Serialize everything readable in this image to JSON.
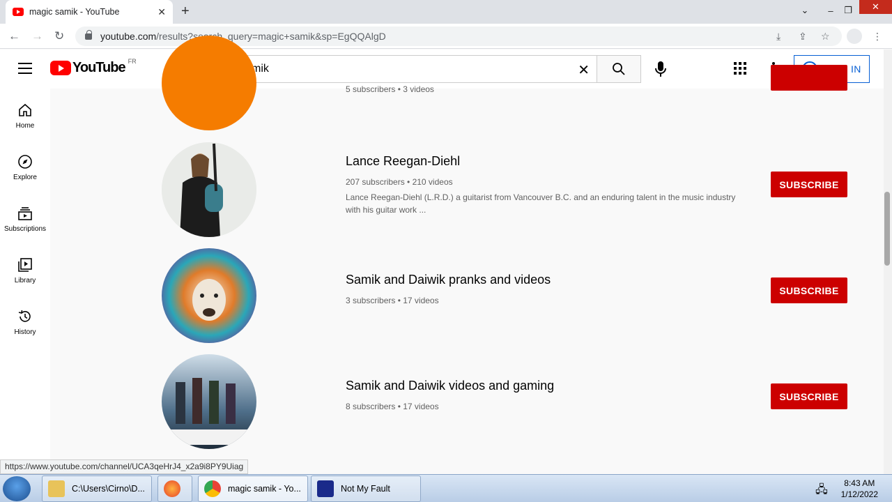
{
  "browser": {
    "tab_title": "magic samik - YouTube",
    "new_tab": "+",
    "url_domain": "youtube.com",
    "url_path": "/results?search_query=magic+samik&sp=EgQQAlgD",
    "status_url": "https://www.youtube.com/channel/UCA3qeHrJ4_x2a9i8PY9Uiag"
  },
  "header": {
    "logo_text": "YouTube",
    "region": "FR",
    "search_value": "magic samik",
    "signin_label": "SIGN IN"
  },
  "sidebar": {
    "items": [
      {
        "label": "Home",
        "icon": "home-icon"
      },
      {
        "label": "Explore",
        "icon": "compass-icon"
      },
      {
        "label": "Subscriptions",
        "icon": "subscriptions-icon"
      },
      {
        "label": "Library",
        "icon": "library-icon"
      },
      {
        "label": "History",
        "icon": "history-icon"
      }
    ]
  },
  "results": [
    {
      "name": "",
      "meta": "5 subscribers • 3 videos",
      "desc": "",
      "subscribe": ""
    },
    {
      "name": "Lance Reegan-Diehl",
      "meta": "207 subscribers • 210 videos",
      "desc": "Lance Reegan-Diehl (L.R.D.) a guitarist from Vancouver B.C. and an enduring talent in the music industry with his guitar work ...",
      "subscribe": "SUBSCRIBE"
    },
    {
      "name": "Samik and Daiwik pranks and videos",
      "meta": "3 subscribers • 17 videos",
      "desc": "",
      "subscribe": "SUBSCRIBE"
    },
    {
      "name": "Samik and Daiwik videos and gaming",
      "meta": "8 subscribers • 17 videos",
      "desc": "",
      "subscribe": "SUBSCRIBE"
    }
  ],
  "taskbar": {
    "items": [
      "C:\\Users\\Cirno\\D...",
      "magic samik - Yo...",
      "Not My Fault"
    ],
    "time": "8:43 AM",
    "date": "1/12/2022"
  },
  "colors": {
    "accent": "#065fd4",
    "subscribe": "#cc0000",
    "brand": "#ff0000"
  }
}
